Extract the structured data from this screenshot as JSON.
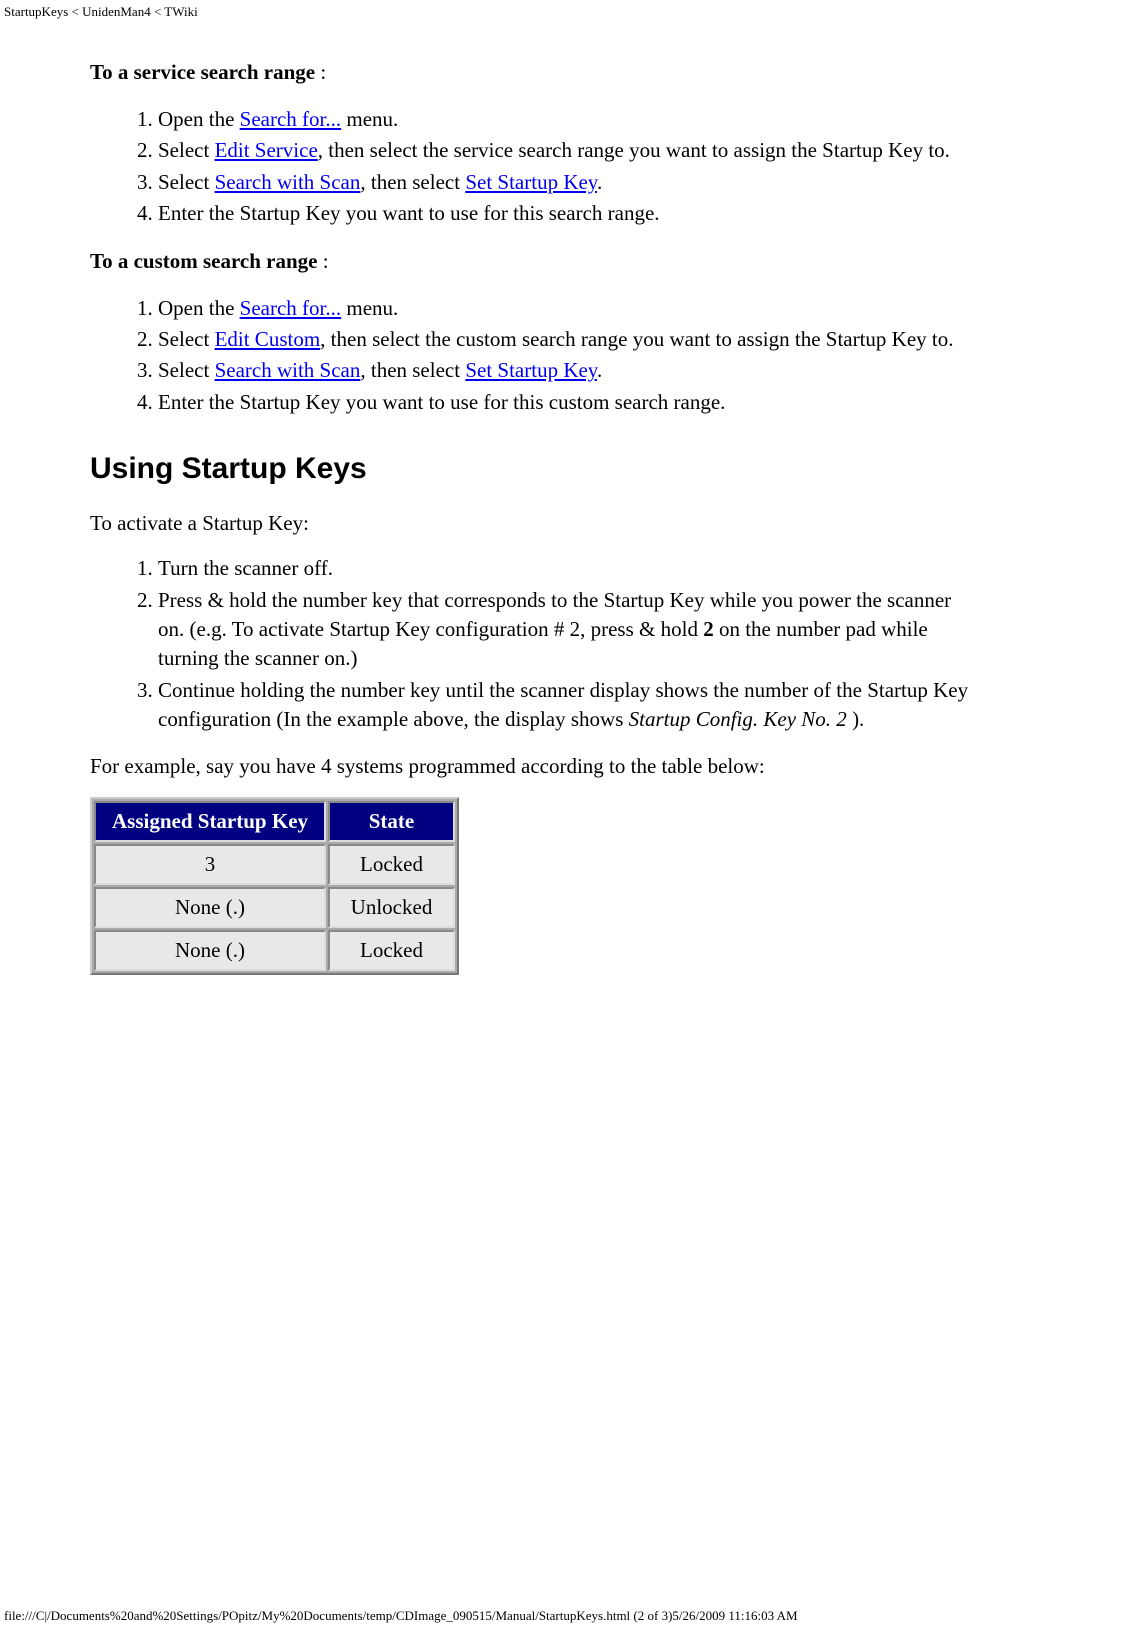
{
  "header": {
    "breadcrumb": "StartupKeys < UnidenMan4 < TWiki"
  },
  "service_range": {
    "lead_bold": "To a service search range",
    "lead_colon": " :",
    "steps": {
      "s1_a": "Open the ",
      "s1_link": "Search for...",
      "s1_b": " menu.",
      "s2_a": "Select ",
      "s2_link": "Edit Service",
      "s2_b": ", then select the service search range you want to assign the Startup Key to.",
      "s3_a": "Select ",
      "s3_link1": "Search with Scan",
      "s3_mid": ", then select ",
      "s3_link2": "Set Startup Key",
      "s3_end": ".",
      "s4": "Enter the Startup Key you want to use for this search range."
    }
  },
  "custom_range": {
    "lead_bold": "To a custom search range",
    "lead_colon": " :",
    "steps": {
      "s1_a": "Open the ",
      "s1_link": "Search for...",
      "s1_b": " menu.",
      "s2_a": "Select ",
      "s2_link": "Edit Custom",
      "s2_b": ", then select the custom search range you want to assign the Startup Key to.",
      "s3_a": "Select ",
      "s3_link1": "Search with Scan",
      "s3_mid": ", then select ",
      "s3_link2": "Set Startup Key",
      "s3_end": ".",
      "s4": "Enter the Startup Key you want to use for this custom search range."
    }
  },
  "using": {
    "heading": "Using Startup Keys",
    "intro": "To activate a Startup Key:",
    "steps": {
      "s1": "Turn the scanner off.",
      "s2_a": "Press & hold the number key that corresponds to the Startup Key while you power the scanner on. (e.g. To activate Startup Key configuration # 2, press & hold ",
      "s2_bold": "2",
      "s2_b": " on the number pad while turning the scanner on.)",
      "s3_a": "Continue holding the number key until the scanner display shows the number of the Startup Key configuration (In the example above, the display shows ",
      "s3_italic": "Startup Config. Key No. 2",
      "s3_b": " )."
    },
    "example_para": "For example, say you have 4 systems programmed according to the table below:"
  },
  "table": {
    "headers": {
      "col1": "Assigned Startup Key",
      "col2": "State"
    },
    "rows": [
      {
        "key": "3",
        "state": "Locked"
      },
      {
        "key": "None (.)",
        "state": "Unlocked"
      },
      {
        "key": "None (.)",
        "state": "Locked"
      }
    ]
  },
  "footer": {
    "text": "file:///C|/Documents%20and%20Settings/POpitz/My%20Documents/temp/CDImage_090515/Manual/StartupKeys.html (2 of 3)5/26/2009 11:16:03 AM"
  }
}
